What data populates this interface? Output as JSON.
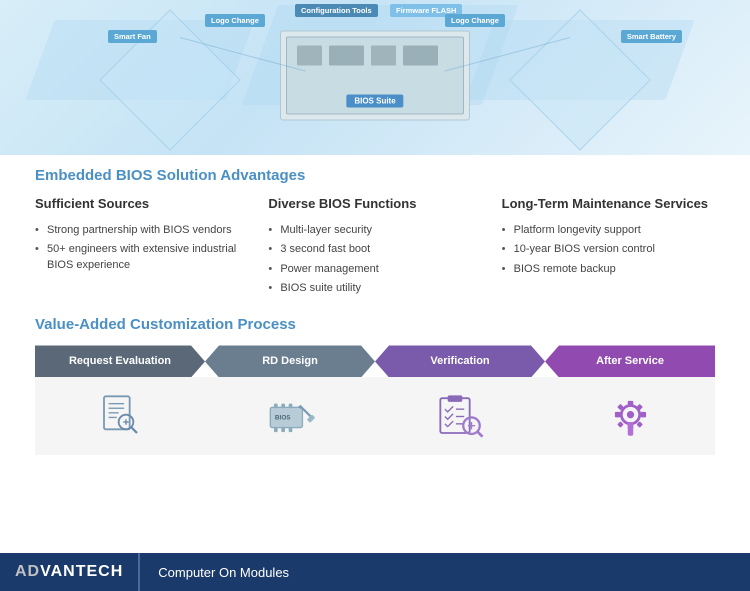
{
  "diagram": {
    "labels": {
      "smart_fan": "Smart Fan",
      "logo_change_left": "Logo Change",
      "config_tools": "Configuration Tools",
      "firmware_flash": "Firmware FLASH",
      "logo_change_right": "Logo Change",
      "smart_battery": "Smart Battery",
      "bios_suite": "BIOS Suite"
    }
  },
  "section1": {
    "title": "Embedded BIOS Solution Advantages",
    "col1": {
      "title": "Sufficient Sources",
      "items": [
        "Strong partnership with BIOS vendors",
        "50+ engineers with extensive industrial BIOS experience"
      ]
    },
    "col2": {
      "title": "Diverse BIOS Functions",
      "items": [
        "Multi-layer security",
        "3 second fast boot",
        "Power management",
        "BIOS suite utility"
      ]
    },
    "col3": {
      "title": "Long-Term Maintenance Services",
      "items": [
        "Platform longevity support",
        "10-year BIOS version control",
        "BIOS remote backup"
      ]
    }
  },
  "section2": {
    "title": "Value-Added Customization Process",
    "steps": [
      {
        "id": "step1",
        "label": "Request Evaluation"
      },
      {
        "id": "step2",
        "label": "RD Design"
      },
      {
        "id": "step3",
        "label": "Verification"
      },
      {
        "id": "step4",
        "label": "After Service"
      }
    ]
  },
  "footer": {
    "brand_ad": "AD",
    "brand_vantech": "VANTECH",
    "subtitle": "Computer On Modules"
  }
}
